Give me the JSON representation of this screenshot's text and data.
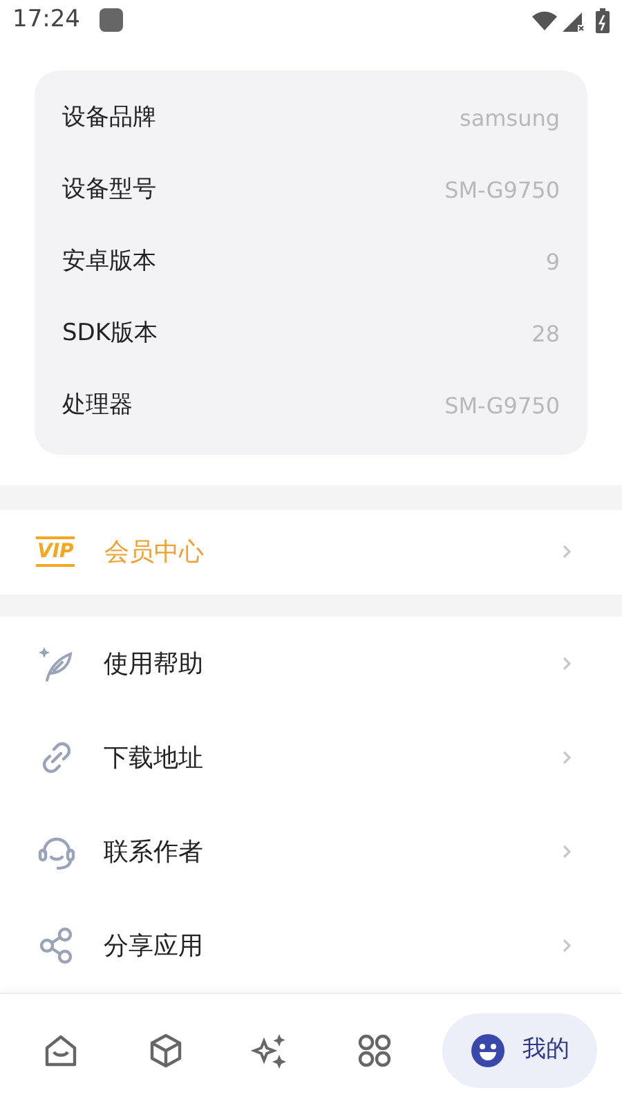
{
  "status_bar": {
    "time": "17:24"
  },
  "device_info": [
    {
      "label": "设备品牌",
      "value": "samsung"
    },
    {
      "label": "设备型号",
      "value": "SM-G9750"
    },
    {
      "label": "安卓版本",
      "value": "9"
    },
    {
      "label": "SDK版本",
      "value": "28"
    },
    {
      "label": "处理器",
      "value": "SM-G9750"
    }
  ],
  "vip_item": {
    "badge": "VIP",
    "label": "会员中心"
  },
  "menu_items": [
    {
      "label": "使用帮助"
    },
    {
      "label": "下载地址"
    },
    {
      "label": "联系作者"
    },
    {
      "label": "分享应用"
    }
  ],
  "bottom_nav": [
    {
      "selected": false
    },
    {
      "selected": false
    },
    {
      "selected": false
    },
    {
      "selected": false
    },
    {
      "label": "我的",
      "selected": true
    }
  ]
}
